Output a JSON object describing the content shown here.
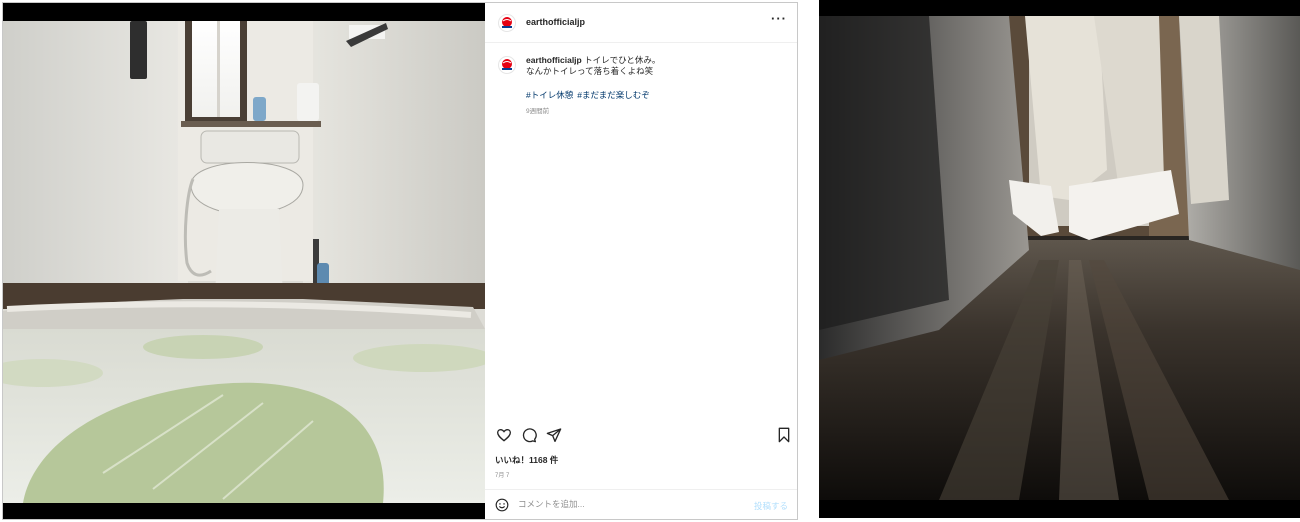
{
  "post": {
    "username": "earthofficialjp",
    "more_label": "···",
    "caption": {
      "username": "earthofficialjp",
      "line1": "トイレでひと休み。",
      "line2": "なんかトイレって落ち着くよね笑",
      "hashtags": [
        "#トイレ休憩",
        "#まだまだ楽しむぞ"
      ],
      "time_ago": "9週間前"
    },
    "likes": "いいね！1168 件",
    "date": "7月 7",
    "comment": {
      "placeholder": "コメントを追加...",
      "post_label": "投稿する"
    }
  },
  "icons": {
    "avatar": "earth-logo-icon",
    "like": "heart-icon",
    "comment": "comment-bubble-icon",
    "share": "paper-plane-icon",
    "save": "bookmark-icon",
    "emoji": "smiley-icon"
  },
  "colors": {
    "hashtag": "#00376b",
    "muted_text": "#8e8e8e",
    "post_button_disabled": "#b2dffc",
    "logo_red": "#e60012",
    "logo_blue": "#0a3d91"
  }
}
